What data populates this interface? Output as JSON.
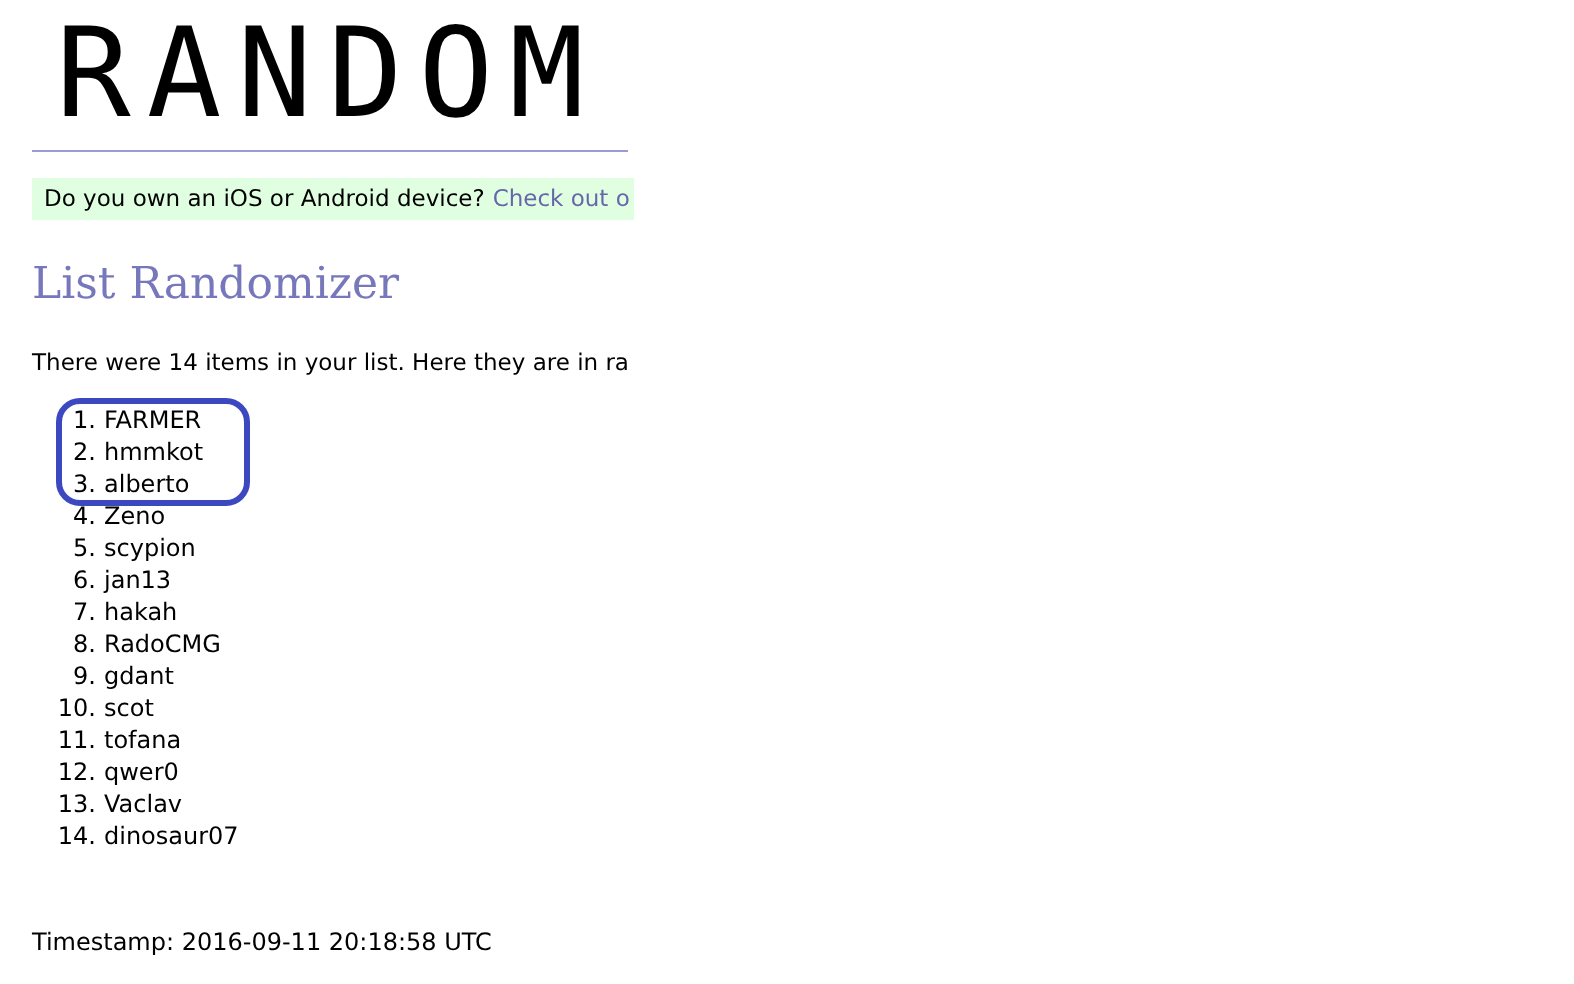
{
  "logo": "RANDOM",
  "banner": {
    "text": "Do you own an iOS or Android device?",
    "link": "Check out o"
  },
  "heading": "List Randomizer",
  "intro": "There were 14 items in your list. Here they are in ra",
  "items": [
    {
      "number": "1.",
      "name": "FARMER",
      "circled": true
    },
    {
      "number": "2.",
      "name": "hmmkot",
      "circled": true
    },
    {
      "number": "3.",
      "name": "alberto",
      "circled": true
    },
    {
      "number": "4.",
      "name": "Zeno",
      "circled": false
    },
    {
      "number": "5.",
      "name": "scypion",
      "circled": false
    },
    {
      "number": "6.",
      "name": "jan13",
      "circled": false
    },
    {
      "number": "7.",
      "name": "hakah",
      "circled": false
    },
    {
      "number": "8.",
      "name": "RadoCMG",
      "circled": false
    },
    {
      "number": "9.",
      "name": "gdant",
      "circled": false
    },
    {
      "number": "10.",
      "name": "scot",
      "circled": false
    },
    {
      "number": "11.",
      "name": "tofana",
      "circled": false
    },
    {
      "number": "12.",
      "name": "qwer0",
      "circled": false
    },
    {
      "number": "13.",
      "name": "Vaclav",
      "circled": false
    },
    {
      "number": "14.",
      "name": "dinosaur07",
      "circled": false
    }
  ],
  "timestamp": "Timestamp: 2016-09-11 20:18:58 UTC"
}
